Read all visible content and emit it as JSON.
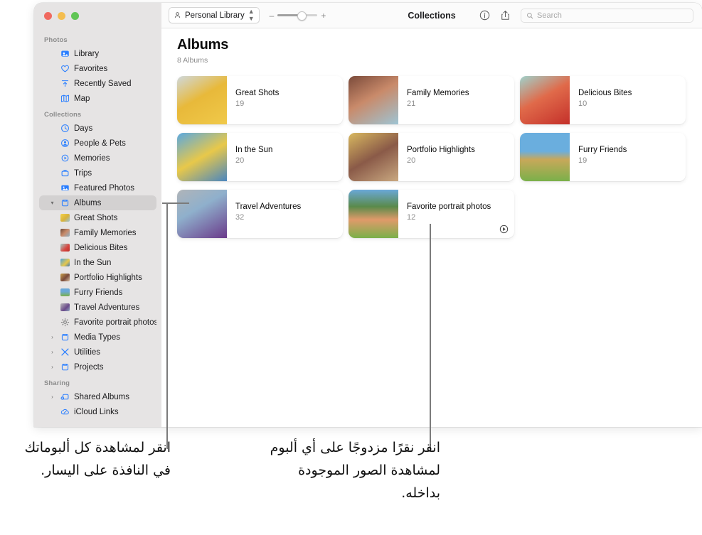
{
  "window": {
    "traffic_lights": [
      "close",
      "minimize",
      "zoom"
    ],
    "toolbar": {
      "library_label": "Personal Library",
      "title": "Collections",
      "zoom_minus": "–",
      "zoom_plus": "+",
      "info_icon": "info-circle-icon",
      "share_icon": "share-icon",
      "search_placeholder": "Search",
      "search_value": ""
    }
  },
  "sidebar": {
    "sections": [
      {
        "title": "Photos",
        "items": [
          {
            "label": "Library",
            "icon": "photos-library-icon",
            "twisty": "",
            "selected": false
          },
          {
            "label": "Favorites",
            "icon": "heart-icon",
            "twisty": "",
            "selected": false
          },
          {
            "label": "Recently Saved",
            "icon": "recently-saved-icon",
            "twisty": "",
            "selected": false
          },
          {
            "label": "Map",
            "icon": "map-icon",
            "twisty": "",
            "selected": false
          }
        ]
      },
      {
        "title": "Collections",
        "items": [
          {
            "label": "Days",
            "icon": "clock-icon",
            "twisty": "",
            "selected": false
          },
          {
            "label": "People & Pets",
            "icon": "person-circle-icon",
            "twisty": "",
            "selected": false
          },
          {
            "label": "Memories",
            "icon": "memories-play-icon",
            "twisty": "",
            "selected": false
          },
          {
            "label": "Trips",
            "icon": "suitcase-icon",
            "twisty": "",
            "selected": false
          },
          {
            "label": "Featured Photos",
            "icon": "featured-photo-icon",
            "twisty": "",
            "selected": false
          },
          {
            "label": "Albums",
            "icon": "album-folder-icon",
            "twisty": "▾",
            "selected": true
          }
        ]
      }
    ],
    "album_children": [
      {
        "label": "Great Shots",
        "icon": "album-thumb-icon"
      },
      {
        "label": "Family Memories",
        "icon": "album-thumb-icon"
      },
      {
        "label": "Delicious Bites",
        "icon": "album-thumb-icon"
      },
      {
        "label": "In the Sun",
        "icon": "album-thumb-icon"
      },
      {
        "label": "Portfolio Highlights",
        "icon": "album-thumb-icon"
      },
      {
        "label": "Furry Friends",
        "icon": "album-thumb-icon"
      },
      {
        "label": "Travel Adventures",
        "icon": "album-thumb-icon"
      },
      {
        "label": "Favorite portrait photos",
        "icon": "gear-icon"
      }
    ],
    "lower_items": [
      {
        "label": "Media Types",
        "icon": "album-folder-icon",
        "twisty": "›"
      },
      {
        "label": "Utilities",
        "icon": "utilities-icon",
        "twisty": "›"
      },
      {
        "label": "Projects",
        "icon": "album-folder-icon",
        "twisty": "›"
      }
    ],
    "sharing": {
      "title": "Sharing",
      "items": [
        {
          "label": "Shared Albums",
          "icon": "shared-album-icon",
          "twisty": "›"
        },
        {
          "label": "iCloud Links",
          "icon": "icloud-link-icon",
          "twisty": ""
        }
      ]
    }
  },
  "main": {
    "title": "Albums",
    "subtitle": "8 Albums",
    "albums": [
      {
        "name": "Great Shots",
        "count": "19",
        "smart": false
      },
      {
        "name": "Family Memories",
        "count": "21",
        "smart": false
      },
      {
        "name": "Delicious Bites",
        "count": "10",
        "smart": false
      },
      {
        "name": "In the Sun",
        "count": "20",
        "smart": false
      },
      {
        "name": "Portfolio Highlights",
        "count": "20",
        "smart": false
      },
      {
        "name": "Furry Friends",
        "count": "19",
        "smart": false
      },
      {
        "name": "Travel Adventures",
        "count": "32",
        "smart": false
      },
      {
        "name": "Favorite portrait photos",
        "count": "12",
        "smart": true
      }
    ]
  },
  "annotations": {
    "left": "انقر لمشاهدة كل ألبوماتك في النافذة على اليسار.",
    "right": "انقر نقرًا مزدوجًا على أي ألبوم لمشاهدة الصور الموجودة بداخله."
  },
  "colors": {
    "sidebar_bg": "#e6e4e4",
    "selected_row": "#d3d1d1",
    "accent_blue": "#2b7fff",
    "callout_line": "#7b7b7b"
  }
}
